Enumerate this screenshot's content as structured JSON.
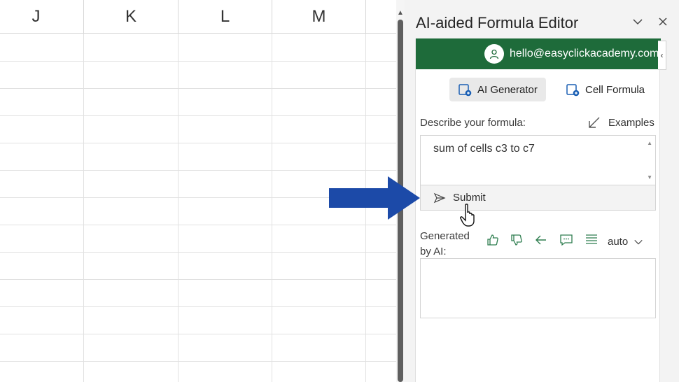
{
  "sheet": {
    "columns": [
      "J",
      "K",
      "L",
      "M"
    ]
  },
  "pane": {
    "title": "AI-aided Formula Editor",
    "account_email": "hello@easyclickacademy.com",
    "modes": {
      "ai_generator": "AI Generator",
      "cell_formula": "Cell Formula"
    },
    "describe_label": "Describe your formula:",
    "examples_label": "Examples",
    "formula_input": "sum of cells c3 to c7",
    "submit_label": "Submit",
    "generated_label": "Generated by AI:",
    "auto_select": "auto",
    "output_text": ""
  },
  "colors": {
    "account_bar": "#1e6b3a",
    "arrow": "#1c4aa8",
    "icon_accent": "#1a5fb4",
    "tool_icon": "#2e7d4f"
  },
  "icons": [
    "person-icon",
    "chevron-down-icon",
    "close-icon",
    "ai-generator-icon",
    "cell-formula-icon",
    "examples-arrow-icon",
    "send-icon",
    "thumbs-up-icon",
    "thumbs-down-icon",
    "back-arrow-icon",
    "comment-icon",
    "list-icon"
  ]
}
